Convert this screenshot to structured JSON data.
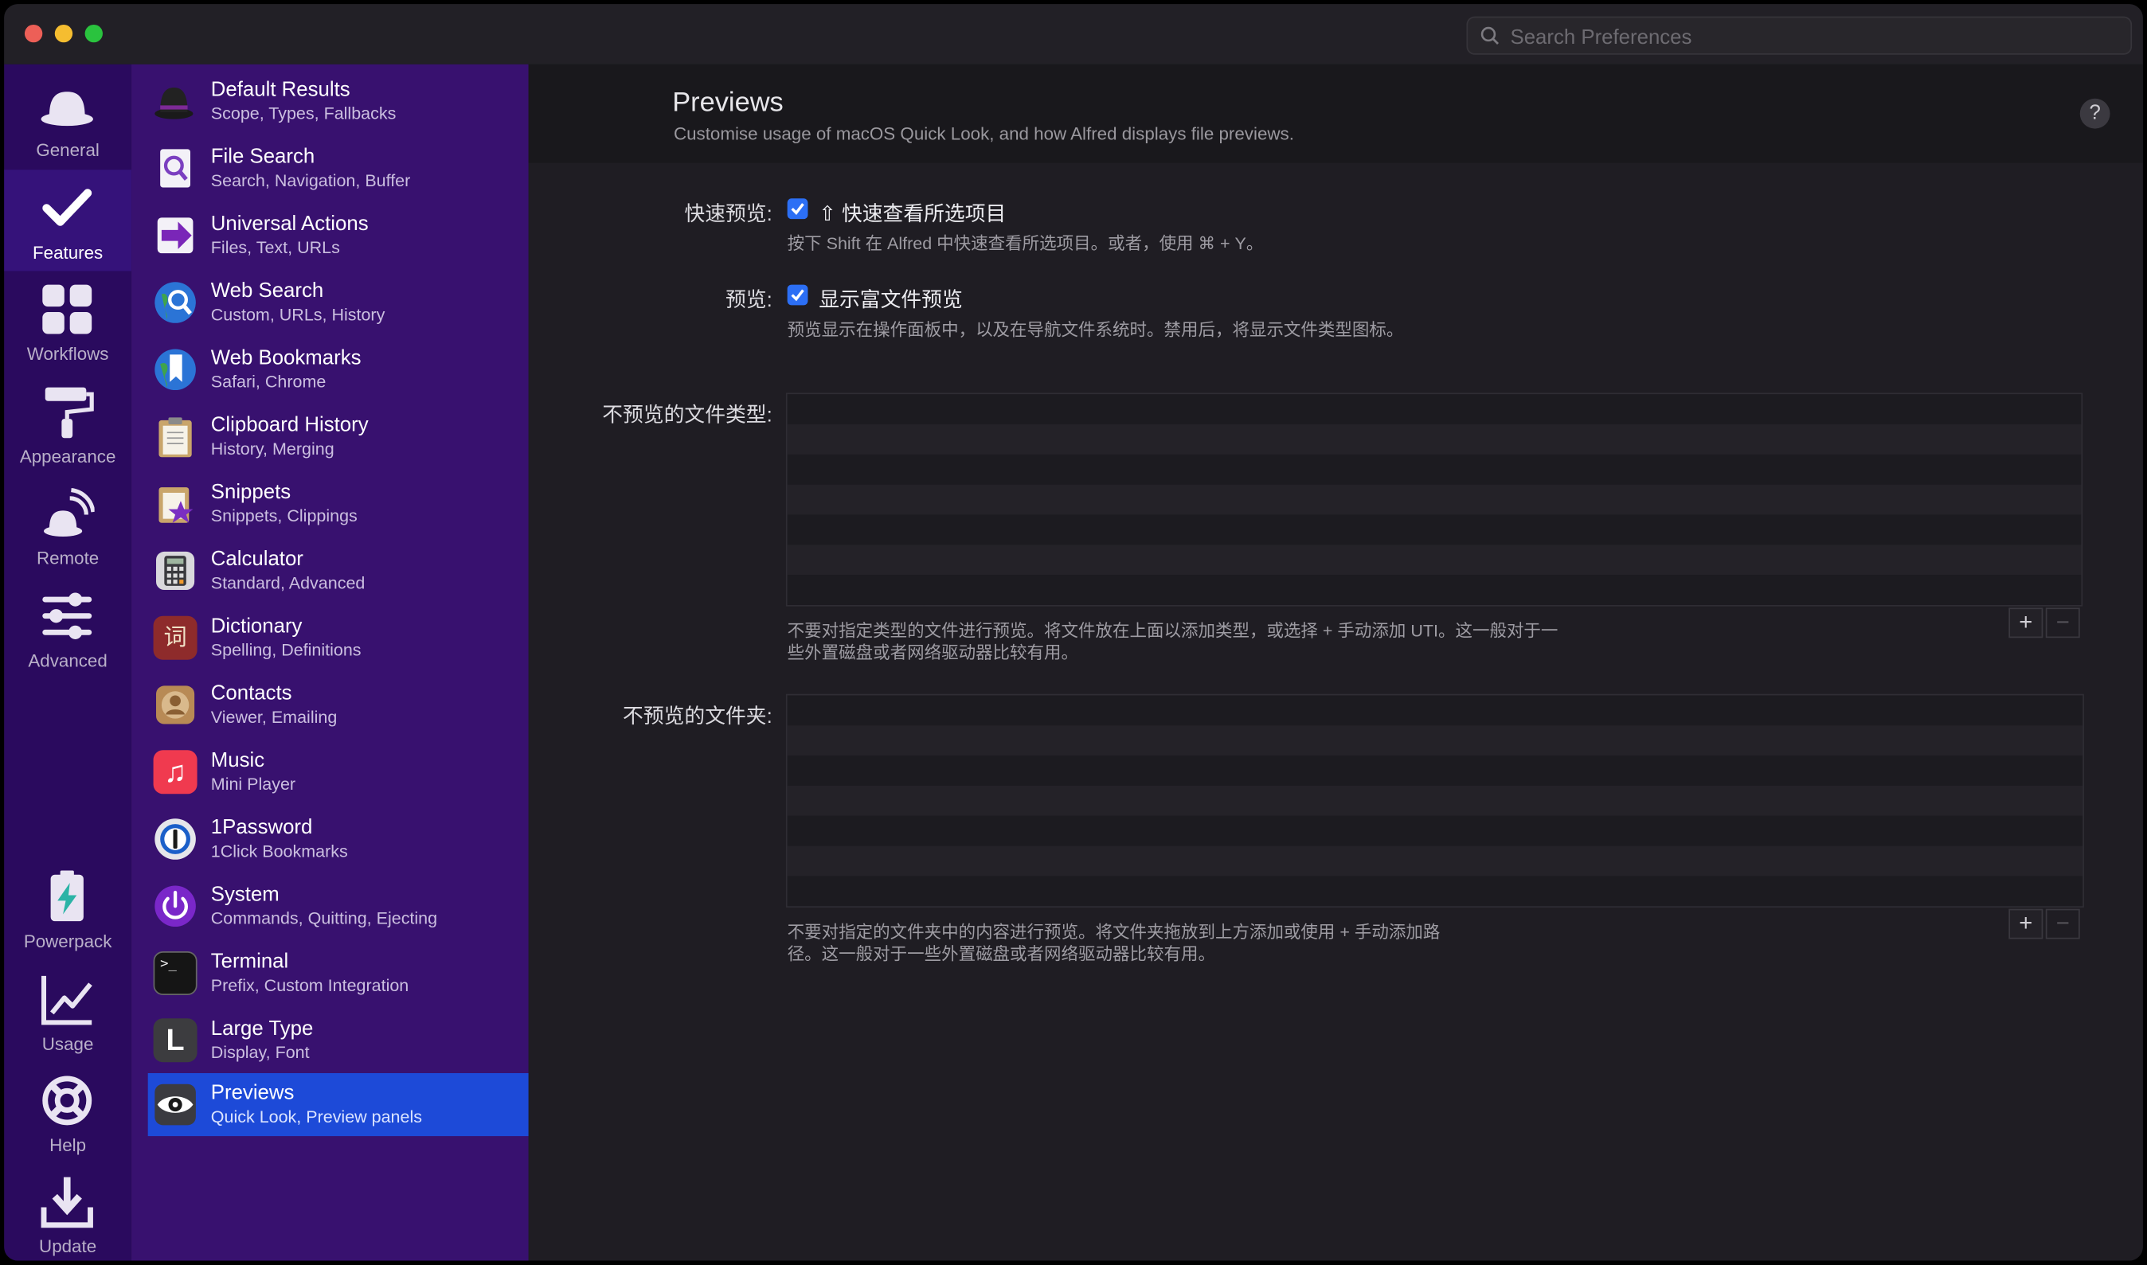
{
  "search": {
    "placeholder": "Search Preferences"
  },
  "iconbar": [
    {
      "label": "General",
      "icon": "hat-icon"
    },
    {
      "label": "Features",
      "icon": "checkmark-icon",
      "active": true
    },
    {
      "label": "Workflows",
      "icon": "grid-icon"
    },
    {
      "label": "Appearance",
      "icon": "paint-roller-icon"
    },
    {
      "label": "Remote",
      "icon": "remote-icon"
    },
    {
      "label": "Advanced",
      "icon": "sliders-icon"
    },
    {
      "label": "Powerpack",
      "icon": "powerpack-icon"
    },
    {
      "label": "Usage",
      "icon": "chart-icon"
    },
    {
      "label": "Help",
      "icon": "lifebuoy-icon"
    },
    {
      "label": "Update",
      "icon": "download-icon"
    }
  ],
  "features": [
    {
      "title": "Default Results",
      "sub": "Scope, Types, Fallbacks",
      "icon": "hat-icon"
    },
    {
      "title": "File Search",
      "sub": "Search, Navigation, Buffer",
      "icon": "file-search-icon"
    },
    {
      "title": "Universal Actions",
      "sub": "Files, Text, URLs",
      "icon": "universal-actions-icon"
    },
    {
      "title": "Web Search",
      "sub": "Custom, URLs, History",
      "icon": "globe-search-icon"
    },
    {
      "title": "Web Bookmarks",
      "sub": "Safari, Chrome",
      "icon": "globe-bookmark-icon"
    },
    {
      "title": "Clipboard History",
      "sub": "History, Merging",
      "icon": "clipboard-icon"
    },
    {
      "title": "Snippets",
      "sub": "Snippets, Clippings",
      "icon": "snippets-icon"
    },
    {
      "title": "Calculator",
      "sub": "Standard, Advanced",
      "icon": "calculator-icon"
    },
    {
      "title": "Dictionary",
      "sub": "Spelling, Definitions",
      "icon": "dictionary-icon",
      "glyph": "词"
    },
    {
      "title": "Contacts",
      "sub": "Viewer, Emailing",
      "icon": "contacts-icon"
    },
    {
      "title": "Music",
      "sub": "Mini Player",
      "icon": "music-icon",
      "glyph": "♫"
    },
    {
      "title": "1Password",
      "sub": "1Click Bookmarks",
      "icon": "onepassword-icon"
    },
    {
      "title": "System",
      "sub": "Commands, Quitting, Ejecting",
      "icon": "power-icon"
    },
    {
      "title": "Terminal",
      "sub": "Prefix, Custom Integration",
      "icon": "terminal-icon",
      "glyph": ">_"
    },
    {
      "title": "Large Type",
      "sub": "Display, Font",
      "icon": "large-type-icon",
      "glyph": "L"
    },
    {
      "title": "Previews",
      "sub": "Quick Look, Preview panels",
      "icon": "eye-icon",
      "active": true
    }
  ],
  "main": {
    "title": "Previews",
    "subtitle": "Customise usage of macOS Quick Look, and how Alfred displays file previews.",
    "help": "?",
    "quicklook_label": "快速预览:",
    "quicklook_checkbox": "⇧ 快速查看所选项目",
    "quicklook_desc": "按下 Shift 在 Alfred 中快速查看所选项目。或者，使用 ⌘ + Y。",
    "preview_label": "预览:",
    "preview_checkbox": "显示富文件预览",
    "preview_desc": "预览显示在操作面板中，以及在导航文件系统时。禁用后，将显示文件类型图标。",
    "types_label": "不预览的文件类型:",
    "types_desc_1": "不要对指定类型的文件进行预览。将文件放在上面以添加类型，或选择 + 手动添加 UTI。这一般对于一",
    "types_desc_2": "些外置磁盘或者网络驱动器比较有用。",
    "folders_label": "不预览的文件夹:",
    "folders_desc_1": "不要对指定的文件夹中的内容进行预览。将文件夹拖放到上方添加或使用 + 手动添加路",
    "folders_desc_2": "径。这一般对于一些外置磁盘或者网络驱动器比较有用。",
    "plus": "+",
    "minus": "−"
  }
}
